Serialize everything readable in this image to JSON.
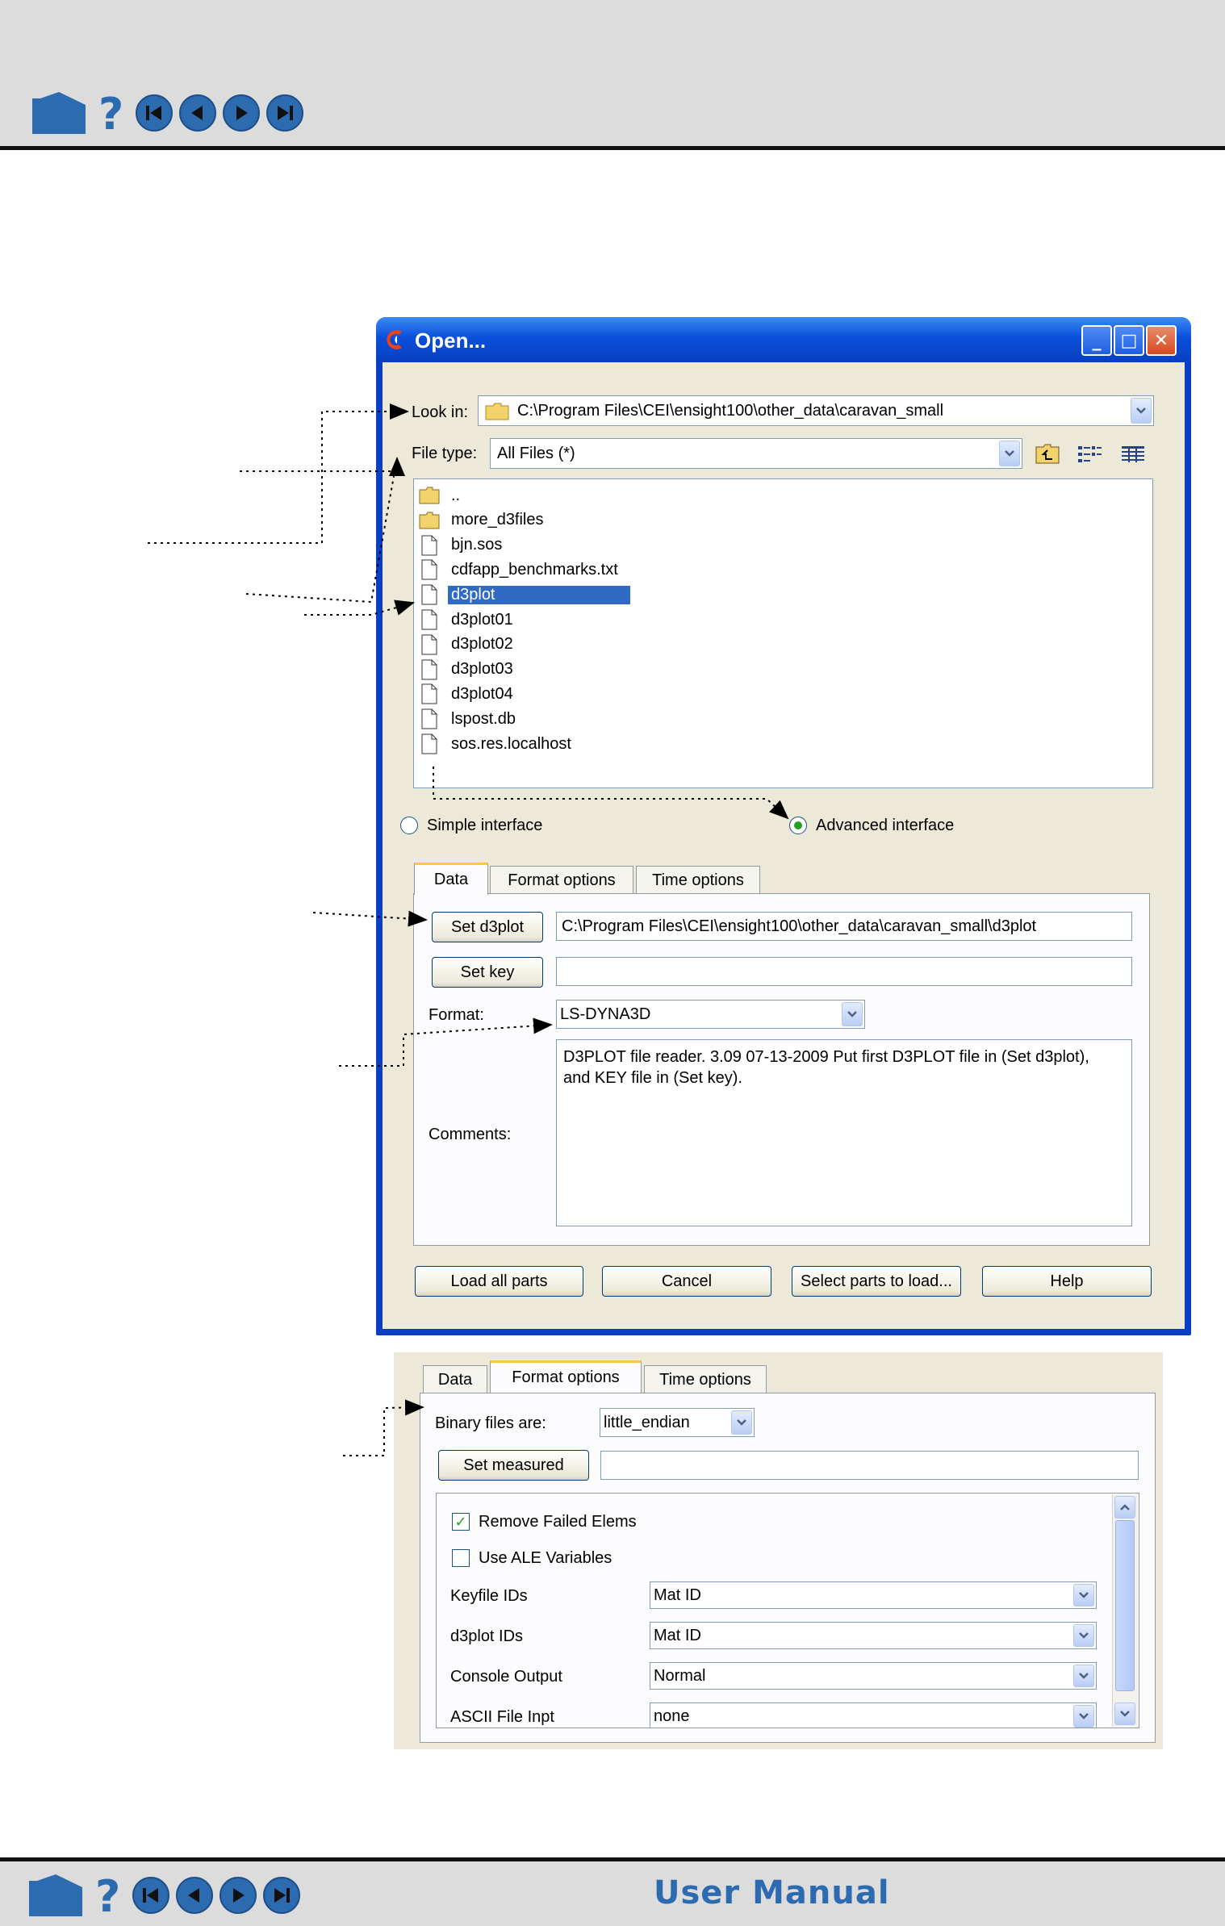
{
  "footer": {
    "manual_label": "User Manual"
  },
  "dialog": {
    "title": "Open...",
    "window_buttons": {
      "minimize": "_",
      "maximize": "□",
      "close": "✕"
    },
    "look_in": {
      "label": "Look in:",
      "value": "C:\\Program Files\\CEI\\ensight100\\other_data\\caravan_small"
    },
    "file_type": {
      "label": "File type:",
      "value": "All Files (*)"
    },
    "files": [
      {
        "name": "..",
        "kind": "folder"
      },
      {
        "name": "more_d3files",
        "kind": "folder"
      },
      {
        "name": "bjn.sos",
        "kind": "file"
      },
      {
        "name": "cdfapp_benchmarks.txt",
        "kind": "file"
      },
      {
        "name": "d3plot",
        "kind": "file",
        "selected": true
      },
      {
        "name": "d3plot01",
        "kind": "file"
      },
      {
        "name": "d3plot02",
        "kind": "file"
      },
      {
        "name": "d3plot03",
        "kind": "file"
      },
      {
        "name": "d3plot04",
        "kind": "file"
      },
      {
        "name": "lspost.db",
        "kind": "file"
      },
      {
        "name": "sos.res.localhost",
        "kind": "file"
      }
    ],
    "interface": {
      "simple": "Simple interface",
      "advanced": "Advanced interface",
      "selected": "advanced"
    },
    "tabs": [
      "Data",
      "Format options",
      "Time options"
    ],
    "data_tab": {
      "set_d3plot_label": "Set d3plot",
      "set_d3plot_value": "C:\\Program Files\\CEI\\ensight100\\other_data\\caravan_small\\d3plot",
      "set_key_label": "Set key",
      "set_key_value": "",
      "format_label": "Format:",
      "format_value": "LS-DYNA3D",
      "comments_label": "Comments:",
      "comments_line1": "D3PLOT file reader.  3.09 07-13-2009  Put first D3PLOT file in (Set d3plot),",
      "comments_line2": "and KEY file in (Set key)."
    },
    "buttons": {
      "load_all": "Load all parts",
      "cancel": "Cancel",
      "select_parts": "Select parts to load...",
      "help": "Help"
    }
  },
  "format_panel": {
    "tabs": [
      "Data",
      "Format options",
      "Time options"
    ],
    "active_tab": "Format options",
    "binary_label": "Binary files are:",
    "binary_value": "little_endian",
    "set_measured_label": "Set measured",
    "set_measured_value": "",
    "remove_failed": {
      "label": "Remove Failed Elems",
      "checked": true
    },
    "use_ale": {
      "label": "Use ALE Variables",
      "checked": false
    },
    "rows": [
      {
        "label": "Keyfile IDs",
        "value": "Mat ID"
      },
      {
        "label": "d3plot IDs",
        "value": "Mat ID"
      },
      {
        "label": "Console Output",
        "value": "Normal"
      },
      {
        "label": "ASCII File Inpt",
        "value": "none"
      }
    ]
  },
  "colors": {
    "nav_blue": "#2d6bb0",
    "xp_title_blue": "#0a4fd9",
    "dialog_face": "#ece9d8",
    "selection": "#316ac5"
  }
}
